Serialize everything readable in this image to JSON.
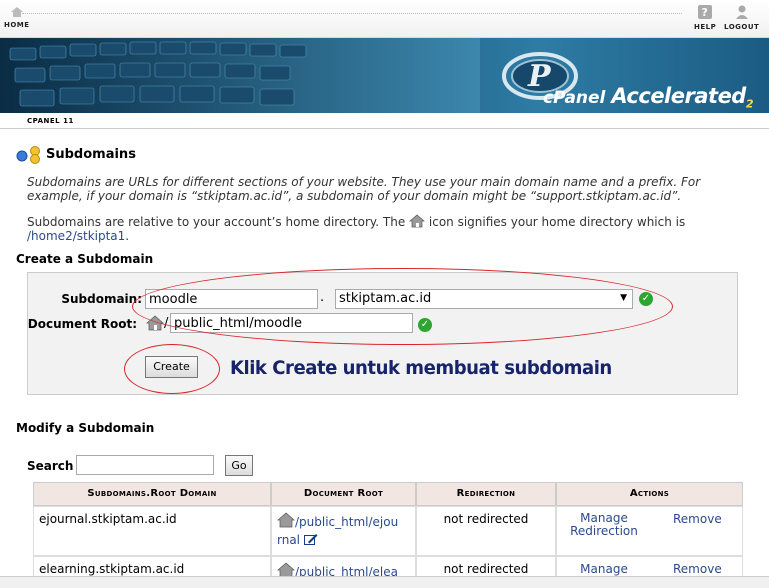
{
  "topbar": {
    "home_label": "HOME",
    "help_label": "HELP",
    "logout_label": "LOGOUT"
  },
  "banner": {
    "logo_text": "cPanel",
    "accelerated_text": "Accelerated",
    "version_mark": "2"
  },
  "tab": {
    "label": "CPANEL 11"
  },
  "page": {
    "title": "Subdomains",
    "intro": "Subdomains are URLs for different sections of your website. They use your main domain name and a prefix. For example, if your domain is “stkiptam.ac.id”, a subdomain of your domain might be “support.stkiptam.ac.id”.",
    "home_dir_text_before": "Subdomains are relative to your account’s home directory. The",
    "home_dir_text_after": "icon signifies your home directory which is",
    "home_dir_path": "/home2/stkipta1",
    "home_dir_trail": "."
  },
  "create": {
    "heading": "Create a Subdomain",
    "subdomain_label": "Subdomain:",
    "subdomain_value": "moodle",
    "dot": ".",
    "domain_selected": "stkiptam.ac.id",
    "docroot_label": "Document Root:",
    "docroot_slash": "/",
    "docroot_value": "public_html/moodle",
    "create_button": "Create",
    "annotation": "Klik Create untuk membuat subdomain"
  },
  "modify": {
    "heading": "Modify a Subdomain",
    "search_label": "Search",
    "search_value": "",
    "go_button": "Go",
    "columns": [
      "Subdomains.Root Domain",
      "Document Root",
      "Redirection",
      "Actions"
    ],
    "rows": [
      {
        "domain": "ejournal.stkiptam.ac.id",
        "docroot_1": "/public_html/ejou",
        "docroot_2": "rnal",
        "redirection": "not redirected",
        "action_manage_1": "Manage",
        "action_manage_2": "Redirection",
        "action_remove": "Remove"
      },
      {
        "domain": "elearning.stkiptam.ac.id",
        "docroot_1": "/public_html/elea",
        "redirection": "not redirected",
        "action_manage_1": "Manage",
        "action_remove": "Remove"
      }
    ]
  },
  "colors": {
    "accent_link": "#2b4a8b",
    "annotation_red": "#d9262c",
    "annotation_text": "#17246a",
    "ok_green": "#2ea52e",
    "header_row": "#f2e6e2"
  }
}
